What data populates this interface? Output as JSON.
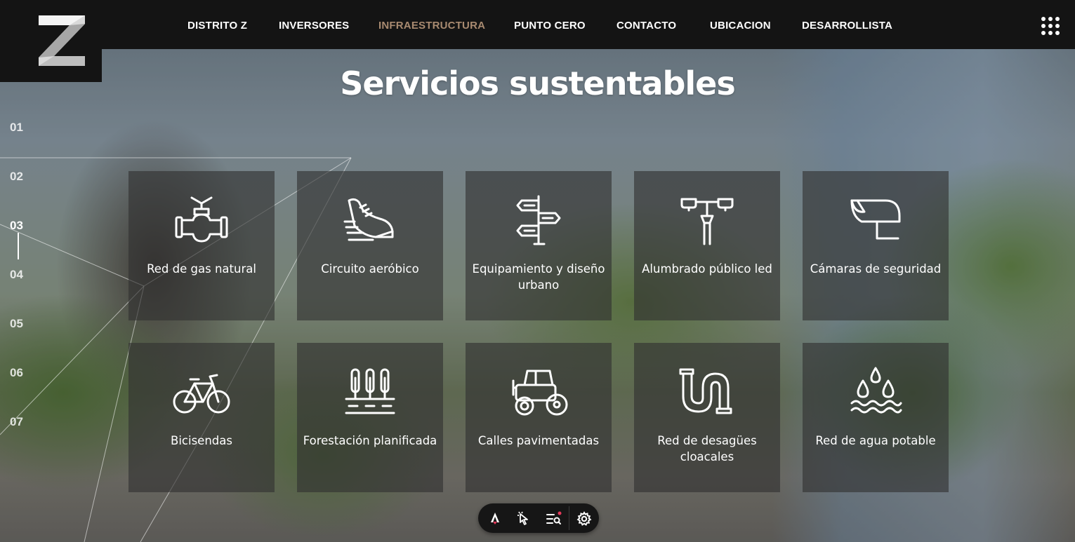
{
  "nav": {
    "items": [
      {
        "label": "DISTRITO Z",
        "active": false
      },
      {
        "label": "INVERSORES",
        "active": false
      },
      {
        "label": "INFRAESTRUCTURA",
        "active": true
      },
      {
        "label": "PUNTO CERO",
        "active": false
      },
      {
        "label": "CONTACTO",
        "active": false
      },
      {
        "label": "UBICACION",
        "active": false
      },
      {
        "label": "DESARROLLISTA",
        "active": false
      }
    ],
    "active_color": "#a88a70"
  },
  "logo": {
    "text": "Z"
  },
  "page": {
    "title": "Servicios sustentables"
  },
  "pager": {
    "items": [
      "01",
      "02",
      "03",
      "04",
      "05",
      "06",
      "07"
    ],
    "active_index": 2
  },
  "services": [
    {
      "label": "Red de gas natural",
      "icon": "gas-valve-icon"
    },
    {
      "label": "Circuito aeróbico",
      "icon": "sneaker-icon"
    },
    {
      "label": "Equipamiento y diseño urbano",
      "icon": "signpost-icon"
    },
    {
      "label": "Alumbrado público led",
      "icon": "street-lamp-icon"
    },
    {
      "label": "Cámaras de seguridad",
      "icon": "security-camera-icon"
    },
    {
      "label": "Bicisendas",
      "icon": "bicycle-icon"
    },
    {
      "label": "Forestación planificada",
      "icon": "trees-icon"
    },
    {
      "label": "Calles pavimentadas",
      "icon": "road-roller-icon"
    },
    {
      "label": "Red de desagües cloacales",
      "icon": "drain-pipe-icon"
    },
    {
      "label": "Red de agua potable",
      "icon": "water-drops-icon"
    }
  ],
  "toolbar": {
    "items": [
      "accessibility-icon",
      "pointer-search-icon",
      "reader-icon",
      "settings-icon"
    ],
    "notification_color": "#e5395a"
  }
}
